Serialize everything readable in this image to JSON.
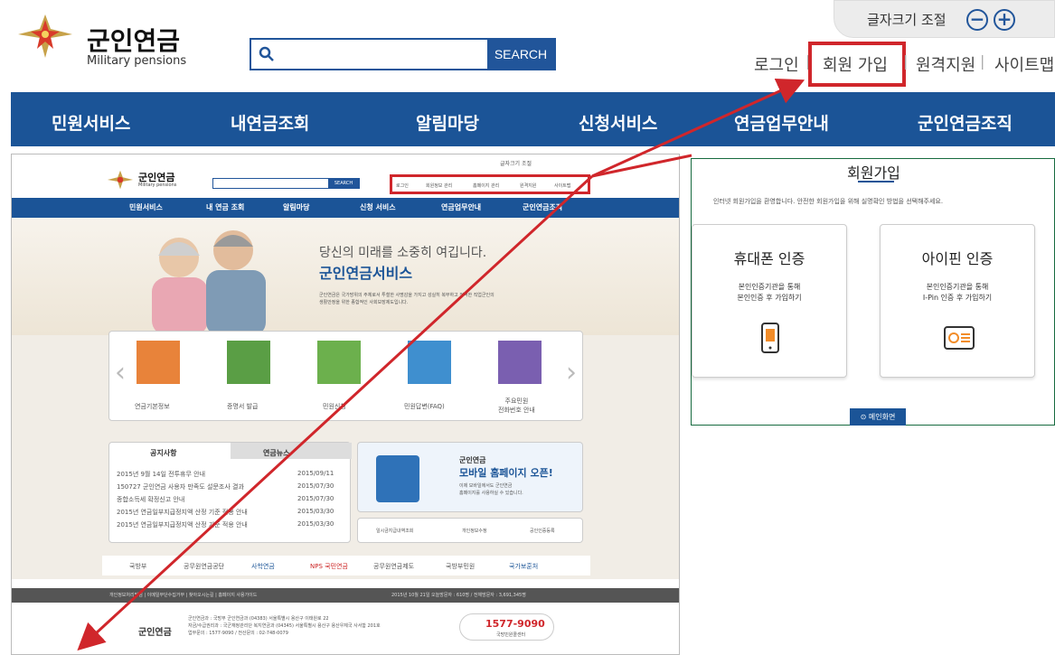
{
  "header": {
    "logo_title": "군인연금",
    "logo_subtitle": "Military pensions",
    "search_button": "SEARCH",
    "font_size_label": "글자크기 조절",
    "font_minus": "−",
    "font_plus": "+",
    "util": [
      "로그인",
      "회원 가입",
      "원격지원",
      "사이트맵"
    ]
  },
  "nav": [
    "민원서비스",
    "내연금조회",
    "알림마당",
    "신청서비스",
    "연금업무안내",
    "군인연금조직"
  ],
  "shot": {
    "logo_title": "군인연금",
    "logo_subtitle": "Military pensions",
    "font_size_label": "글자크기 조절",
    "search_button": "SEARCH",
    "util": [
      "로그인",
      "회원정보 관리",
      "홈페이지 관리",
      "원격지원",
      "사이트맵"
    ],
    "nav": [
      "민원서비스",
      "내 연금 조회",
      "알림마당",
      "신청 서비스",
      "연금업무안내",
      "군인연금조직"
    ],
    "hero_line1": "당신의 미래를 소중히 여깁니다.",
    "hero_line2": "군인연금서비스",
    "hero_desc1": "군인연금은 국가방위의 주체로서 투철한 사명감을 가지고 성실히 복무하고 전역한 직업군인의",
    "hero_desc2": "생활안정을 위한 종합적인 사회보장제도입니다.",
    "services": [
      {
        "label": "연금기본정보",
        "color": "#e8833a"
      },
      {
        "label": "증명서 발급",
        "color": "#5a9e45"
      },
      {
        "label": "민원신청",
        "color": "#6cb04d"
      },
      {
        "label": "민원답변(FAQ)",
        "color": "#3f8fcf"
      },
      {
        "label": "주요민원\n전화번호 안내",
        "color": "#7a5fb0"
      }
    ],
    "notice_tab1": "공지사항",
    "notice_tab2": "연금뉴스",
    "notices": [
      {
        "title": "2015년 9월 14일 전투휴무 안내",
        "date": "2015/09/11"
      },
      {
        "title": "150727 군인연금 사용자 만족도 설문조사 결과",
        "date": "2015/07/30"
      },
      {
        "title": "종합소득세 확정신고 안내",
        "date": "2015/07/30"
      },
      {
        "title": "2015년 연금일부지급정지액 산정 기준 적용 안내",
        "date": "2015/03/30"
      },
      {
        "title": "2015년 연금일부지급정지액 산정 기준 적용 안내",
        "date": "2015/03/30"
      }
    ],
    "mobile_line1": "군인연금",
    "mobile_line2": "모바일 홈페이지 오픈!",
    "mobile_desc1": "이제 모바일에서도 군인연금",
    "mobile_desc2": "홈페이지를 사용하실 수 있습니다.",
    "quick": [
      "일시금지급내역조회",
      "개인정보수정",
      "공인인증등록"
    ],
    "partners": [
      "국방부",
      "공무원연금공단",
      "사학연금",
      "NPS 국민연금",
      "공무원연금제도",
      "국방부민원",
      "국가보훈처"
    ],
    "bottom_links": "개인정보처리방침 | 이메일무단수집거부 | 찾아오시는길 | 홈페이지 사용가이드",
    "visitors": "2015년 10월 21일  오늘방문자 : 610명  /  전체방문자 : 3,691,345명",
    "address1": "군인연금과 : 국방부 군인연금과 (04383) 서울특별시 용산구 이태원로 22",
    "address2": "자금/수급권리과 : 국군재정관리단 복지연금과 (04345) 서울특별시 용산구 용산우체국 사서함 201호",
    "address3": "업무문의 : 1577-9090 / 전산문의 : 02-748-0079",
    "phone": "1577-9090",
    "phone_label": "국방민원콜센터"
  },
  "register": {
    "title": "회원가입",
    "desc": "인터넷 회원가입을 환영합니다. 안전한 회원가입을 위해 실명확인 방법을 선택해주세요.",
    "cards": [
      {
        "title": "휴대폰 인증",
        "desc1": "본인인증기관을 통해",
        "desc2": "본인인증 후 가입하기"
      },
      {
        "title": "아이핀 인증",
        "desc1": "본인인증기관을 통해",
        "desc2": "I-Pin 인증 후 가입하기"
      }
    ],
    "main_button": "메인화면"
  },
  "colors": {
    "brand": "#1b5497",
    "highlight": "#d0262b",
    "border_green": "#176b3f"
  }
}
